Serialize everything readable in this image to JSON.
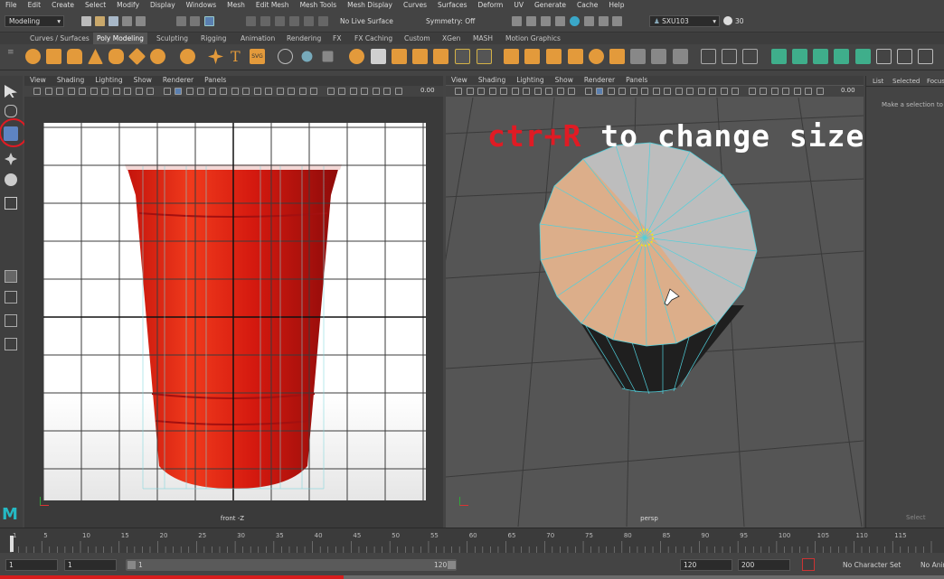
{
  "menubar": [
    "File",
    "Edit",
    "Create",
    "Select",
    "Modify",
    "Display",
    "Windows",
    "Mesh",
    "Edit Mesh",
    "Mesh Tools",
    "Mesh Display",
    "Curves",
    "Surfaces",
    "Deform",
    "UV",
    "Generate",
    "Cache",
    "Help"
  ],
  "status": {
    "mode": "Modeling",
    "live_surface": "No Live Surface",
    "symmetry": "Symmetry: Off",
    "user": "SXU103",
    "fps": "30"
  },
  "shelf_tabs": [
    "Curves / Surfaces",
    "Poly Modeling",
    "Sculpting",
    "Rigging",
    "Animation",
    "Rendering",
    "FX",
    "FX Caching",
    "Custom",
    "XGen",
    "MASH",
    "Motion Graphics"
  ],
  "shelf_active_tab": "Poly Modeling",
  "viewport_menu": [
    "View",
    "Shading",
    "Lighting",
    "Show",
    "Renderer",
    "Panels"
  ],
  "viewport_value": "0.00",
  "front_camera": "front -Z",
  "persp_camera": "persp",
  "overlay_text": {
    "red": "ctr+R",
    "white": " to change size"
  },
  "attr_panel": {
    "tabs": [
      "List",
      "Selected",
      "Focus"
    ],
    "hint": "Make a selection to",
    "button": "Select"
  },
  "timeline": {
    "ticks": [
      "1",
      "5",
      "10",
      "15",
      "20",
      "25",
      "30",
      "35",
      "40",
      "45",
      "50",
      "55",
      "60",
      "65",
      "70",
      "75",
      "80",
      "85",
      "90",
      "95",
      "100",
      "105",
      "110",
      "115"
    ],
    "ticks_r": [
      "1"
    ]
  },
  "range": {
    "start": "1",
    "current": "1",
    "inner_start": "1",
    "inner_end": "120",
    "end": "120",
    "max": "200",
    "char_set": "No Character Set",
    "anim_layer": "No Anim"
  },
  "colors": {
    "accent_red": "#e01b24",
    "maya_teal": "#25b9c4",
    "cup_red": "#d41e16"
  }
}
